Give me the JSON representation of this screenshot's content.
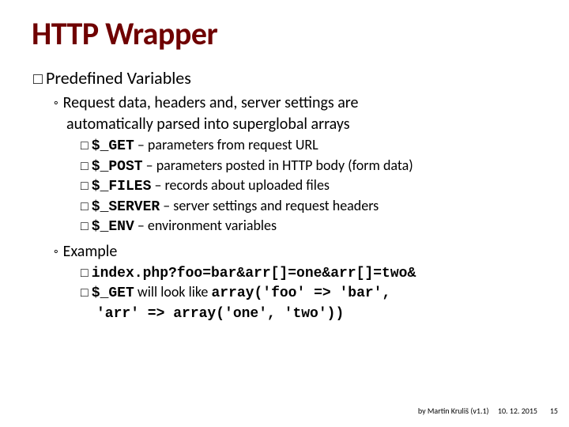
{
  "title": "HTTP Wrapper",
  "section": {
    "bullet": "□",
    "label": "Predefined",
    "rest": " Variables"
  },
  "intro": {
    "bullet": "◦",
    "line1": "Request data, headers and, server settings are",
    "line2": "automatically parsed into superglobal arrays"
  },
  "vars": [
    {
      "bullet": "□",
      "code": "$_GET",
      "desc": " – parameters from request URL"
    },
    {
      "bullet": "□",
      "code": "$_POST",
      "desc": " – parameters posted in HTTP body (form data)"
    },
    {
      "bullet": "□",
      "code": "$_FILES",
      "desc": " – records about uploaded files"
    },
    {
      "bullet": "□",
      "code": "$_SERVER",
      "desc": " – server settings and request headers"
    },
    {
      "bullet": "□",
      "code": "$_ENV",
      "desc": " – environment variables"
    }
  ],
  "example": {
    "bullet": "◦",
    "label": "Example",
    "url_bullet": "□",
    "url": "index.php?foo=bar&arr[]=one&arr[]=two&",
    "res_bullet": "□",
    "res_code1": "$_GET",
    "res_mid": " will look like ",
    "res_code2": "array('foo' => 'bar',",
    "res_code3": "'arr' => array('one', 'two'))"
  },
  "footer": {
    "author": "by Martin Kruliš (v1.1)",
    "date": "10. 12. 2015",
    "page": "15"
  }
}
